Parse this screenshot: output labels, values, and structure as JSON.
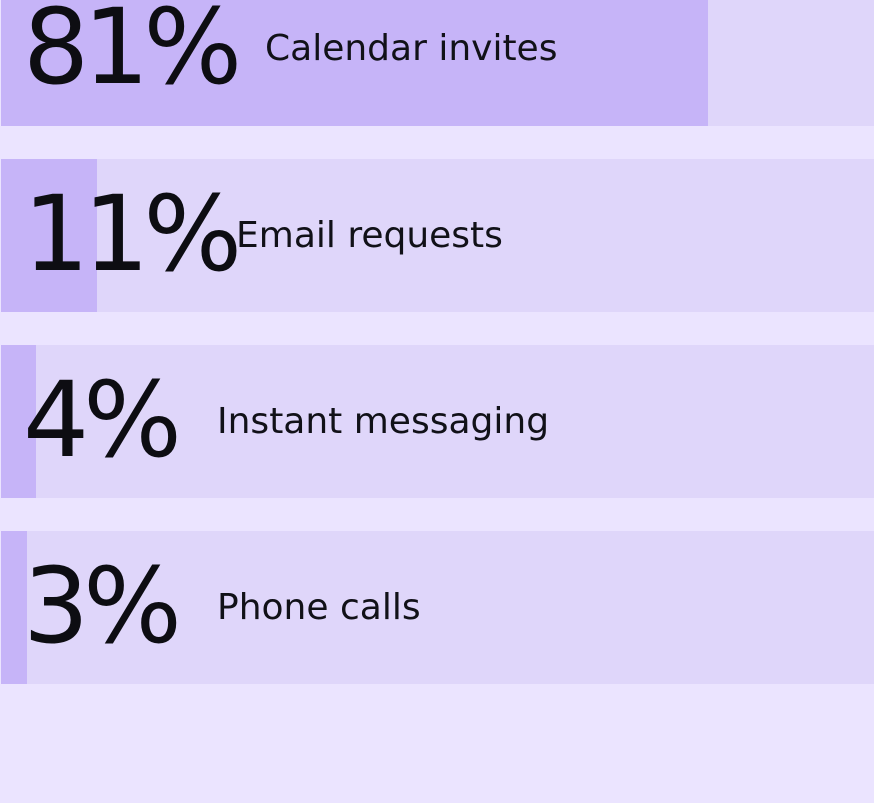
{
  "colors": {
    "background": "#ebe4ff",
    "track": "#dfd6fa",
    "fill": "#c6b4f8",
    "text": "#0d0d12"
  },
  "chart_data": {
    "type": "bar",
    "orientation": "horizontal",
    "categories": [
      "Calendar invites",
      "Email requests",
      "Instant messaging",
      "Phone calls"
    ],
    "values": [
      81,
      11,
      4,
      3
    ],
    "value_labels": [
      "81%",
      "11%",
      "4%",
      "3%"
    ],
    "unit": "%",
    "xlim": [
      0,
      100
    ]
  }
}
